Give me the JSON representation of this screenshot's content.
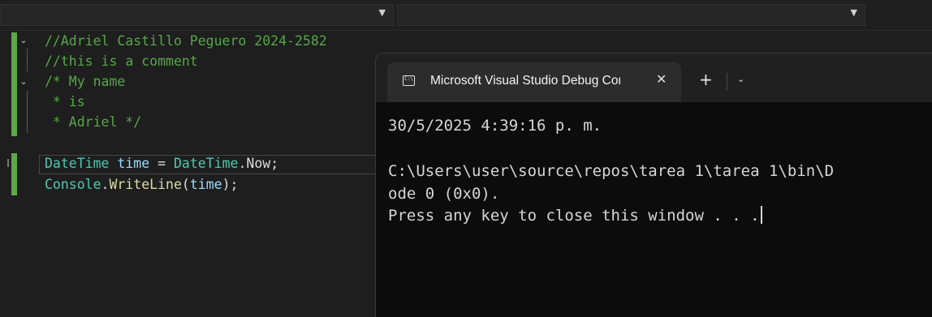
{
  "editor": {
    "lines": [
      {
        "segments": [
          {
            "cls": "c-comment",
            "text": "//Adriel Castillo Peguero 2024-2582"
          }
        ]
      },
      {
        "segments": [
          {
            "cls": "c-comment",
            "text": "//this is a comment"
          }
        ]
      },
      {
        "segments": [
          {
            "cls": "c-comment",
            "text": "/* My name"
          }
        ]
      },
      {
        "segments": [
          {
            "cls": "c-comment",
            "text": " * is"
          }
        ]
      },
      {
        "segments": [
          {
            "cls": "c-comment",
            "text": " * Adriel */"
          }
        ]
      },
      {
        "segments": []
      },
      {
        "segments": [
          {
            "cls": "c-type",
            "text": "DateTime"
          },
          {
            "cls": "c-plain",
            "text": " "
          },
          {
            "cls": "c-var",
            "text": "time"
          },
          {
            "cls": "c-plain",
            "text": " = "
          },
          {
            "cls": "c-type",
            "text": "DateTime"
          },
          {
            "cls": "c-plain",
            "text": "."
          },
          {
            "cls": "c-plain",
            "text": "Now"
          },
          {
            "cls": "c-plain",
            "text": ";"
          }
        ]
      },
      {
        "segments": [
          {
            "cls": "c-type",
            "text": "Console"
          },
          {
            "cls": "c-plain",
            "text": "."
          },
          {
            "cls": "c-method",
            "text": "WriteLine"
          },
          {
            "cls": "c-plain",
            "text": "("
          },
          {
            "cls": "c-var",
            "text": "time"
          },
          {
            "cls": "c-plain",
            "text": ");"
          }
        ]
      }
    ]
  },
  "terminal": {
    "tab_title": "Microsoft Visual Studio Debug Console",
    "output_lines": [
      "30/5/2025 4:39:16 p. m.",
      "",
      "C:\\Users\\user\\source\\repos\\tarea 1\\tarea 1\\bin\\D",
      "ode 0 (0x0).",
      "Press any key to close this window . . ."
    ]
  },
  "icons": {
    "fold": "chevron-down-icon",
    "dropdown": "caret-down-icon",
    "terminal_tab": "console-icon",
    "close": "close-icon",
    "new_tab": "plus-icon",
    "tab_menu": "chevron-down-icon"
  },
  "colors": {
    "comment": "#57a64a",
    "type": "#4ec9b0",
    "variable": "#9cdcfe",
    "method": "#dcdcaa",
    "change_indicator": "#5fa84a"
  }
}
